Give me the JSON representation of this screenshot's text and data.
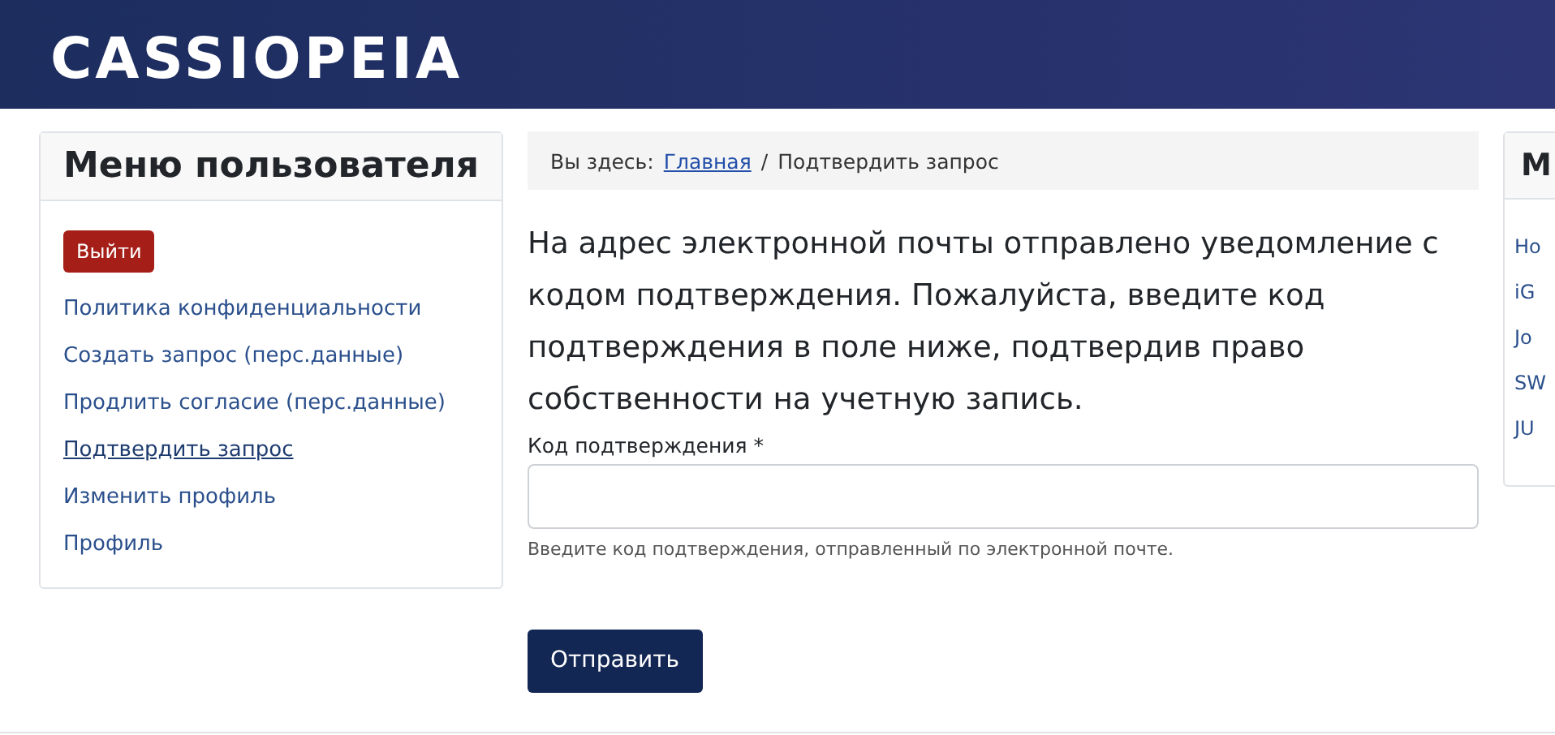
{
  "header": {
    "logo": "CASSIOPEIA"
  },
  "user_menu": {
    "title": "Меню пользователя",
    "logout_button": "Выйти",
    "items": [
      {
        "label": "Политика конфиденциальности",
        "selected": false
      },
      {
        "label": "Создать запрос (перс.данные)",
        "selected": false
      },
      {
        "label": "Продлить согласие (перс.данные)",
        "selected": false
      },
      {
        "label": "Подтвердить запрос",
        "selected": true
      },
      {
        "label": "Изменить профиль",
        "selected": false
      },
      {
        "label": "Профиль",
        "selected": false
      }
    ]
  },
  "breadcrumb": {
    "prefix": "Вы здесь:",
    "separator": "/",
    "items": [
      {
        "label": "Главная",
        "kind": "link"
      },
      {
        "label": "Подтвердить запрос",
        "kind": "current"
      }
    ]
  },
  "message": "На адрес электронной почты отправлено уведомление с кодом подтверждения. Пожалуйста, введите код подтверждения в поле ниже, подтвердив право собственности на учетную запись.",
  "form": {
    "label": "Код подтверждения *",
    "hint": "Введите код подтверждения, отправленный по электронной почте.",
    "submit_button": "Отправить"
  },
  "right_module": {
    "title": "М",
    "items": [
      "Ho",
      "iG",
      "Jo",
      "SW",
      "JU"
    ]
  }
}
